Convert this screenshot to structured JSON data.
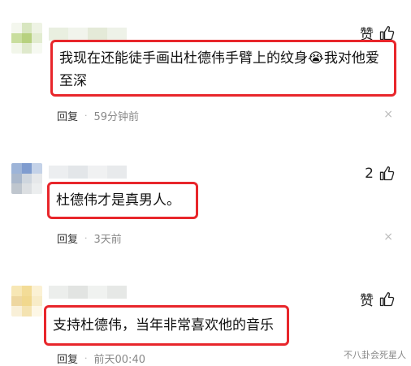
{
  "comments": [
    {
      "like_label": "赞",
      "text": "我现在还能徒手画出杜德伟手臂上的纹身😭我对他爱至深",
      "reply_label": "回复",
      "dot": "·",
      "time": "59分钟前",
      "close": "×",
      "avatar_colors": [
        "#f4f7ee",
        "#d8e6c0",
        "#eef3e4",
        "#c9de9e",
        "#b7d17f",
        "#e2ecd0",
        "#f2f6ea",
        "#dfe9cc",
        "#f6f9f1"
      ]
    },
    {
      "like_label": "2",
      "text": "杜德伟才是真男人。",
      "reply_label": "回复",
      "dot": "·",
      "time": "3天前",
      "close": "×",
      "avatar_colors": [
        "#9db4d8",
        "#7f9ccf",
        "#c4d2e8",
        "#aab8cc",
        "#cfd6de",
        "#e6e8ea",
        "#bfc6ce",
        "#dcdfe2",
        "#eceeef"
      ]
    },
    {
      "like_label": "赞",
      "text": "支持杜德伟，当年非常喜欢他的音乐",
      "reply_label": "回复",
      "dot": "·",
      "time": "前天00:40",
      "close": "",
      "avatar_colors": [
        "#f7e7b5",
        "#f3dc97",
        "#fbf1d4",
        "#eed7a0",
        "#f1d88e",
        "#f8ecc8",
        "#f9f0d8",
        "#f4e3b1",
        "#fdf7e6"
      ]
    }
  ],
  "watermark": "不八卦会死星人",
  "colors": {
    "highlight": "#e8262b",
    "meta": "#888888"
  }
}
